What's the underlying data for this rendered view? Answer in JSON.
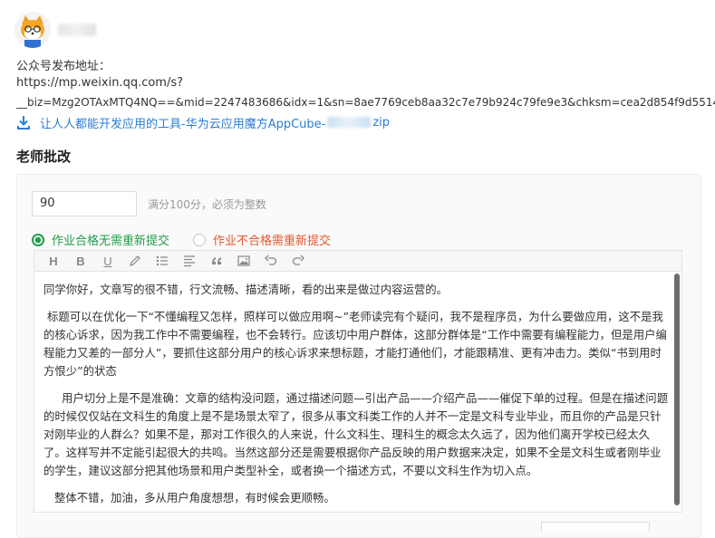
{
  "user": {
    "avatar_icon": "fox-cartoon-avatar",
    "username": ""
  },
  "address": {
    "label": "公众号发布地址：",
    "url_line1": "https://mp.weixin.qq.com/s?",
    "url_line2": "__biz=Mzg2OTAxMTQ4NQ==&mid=2247483686&idx=1&sn=8ae7769ceb8aa32c7e79b924c79fe9e3&chksm=cea2d854f9d5514"
  },
  "attachment": {
    "icon": "download-icon",
    "name_prefix": "让人人都能开发应用的工具-华为云应用魔方AppCube-",
    "name_suffix": "zip"
  },
  "grading": {
    "title": "老师批改",
    "score_value": "90",
    "score_hint": "满分100分，必须为整数",
    "option_pass": "作业合格无需重新提交",
    "option_fail": "作业不合格需重新提交",
    "selected": "pass"
  },
  "toolbar": {
    "heading": "H",
    "bold": "B",
    "underline": "U"
  },
  "editor": {
    "paragraphs": [
      "同学你好，文章写的很不错，行文流畅、描述清晰，看的出来是做过内容运营的。",
      "标题可以在优化一下“不懂编程又怎样，照样可以做应用啊~”老师读完有个疑问，我不是程序员，为什么要做应用，这不是我的核心诉求，因为我工作中不需要编程，也不会转行。应该切中用户群体，这部分群体是“工作中需要有编程能力，但是用户编程能力又差的一部分人”，要抓住这部分用户的核心诉求来想标题，才能打通他们，才能跟精准、更有冲击力。类似“书到用时方恨少”的状态",
      "用户切分上是不是准确：文章的结构没问题，通过描述问题—引出产品——介绍产品——催促下单的过程。但是在描述问题的时候仅仅站在文科生的角度上是不是场景太窄了，很多从事文科类工作的人并不一定是文科专业毕业，而且你的产品是只针对刚毕业的人群么？如果不是，那对工作很久的人来说，什么文科生、理科生的概念太久远了，因为他们离开学校已经太久了。这样写并不定能引起很大的共鸣。当然这部分还是需要根据你产品反映的用户数据来决定，如果不全是文科生或者刚毕业的学生，建议这部分把其他场景和用户类型补全，或者换一个描述方式，不要以文科生作为切入点。",
      "整体不错，加油，多从用户角度想想，有时候会更顺畅。"
    ]
  },
  "colors": {
    "link": "#2d7dd2",
    "pass": "#1e9e4a",
    "fail": "#e4572e"
  }
}
